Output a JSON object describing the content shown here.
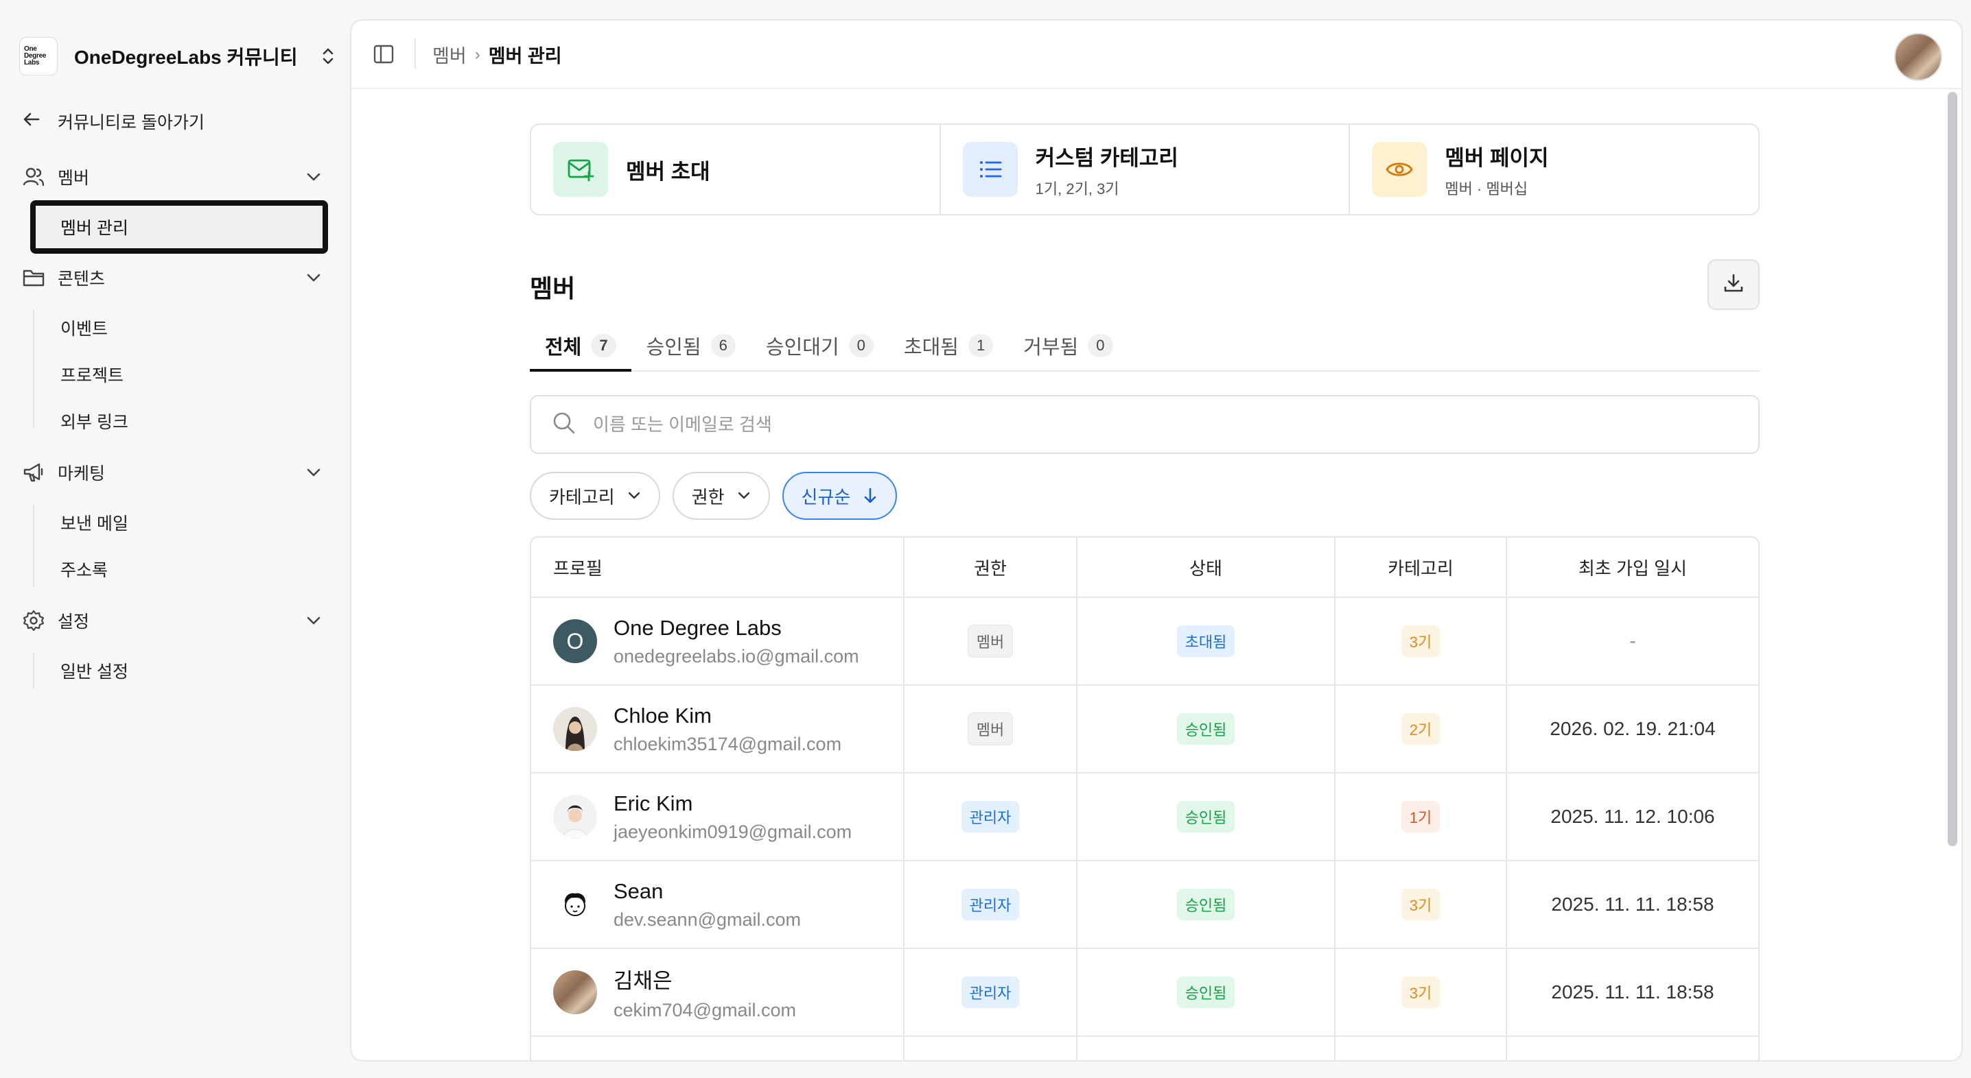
{
  "workspace": {
    "logo_text": "One Degree Labs",
    "name": "OneDegreeLabs 커뮤니티"
  },
  "sidebar": {
    "back_label": "커뮤니티로 돌아가기",
    "sections": [
      {
        "label": "멤버",
        "icon": "users-icon",
        "items": [
          {
            "label": "멤버 관리",
            "active": true
          }
        ]
      },
      {
        "label": "콘텐츠",
        "icon": "folder-icon",
        "items": [
          {
            "label": "이벤트"
          },
          {
            "label": "프로젝트"
          },
          {
            "label": "외부 링크"
          }
        ]
      },
      {
        "label": "마케팅",
        "icon": "megaphone-icon",
        "items": [
          {
            "label": "보낸 메일"
          },
          {
            "label": "주소록"
          }
        ]
      },
      {
        "label": "설정",
        "icon": "gear-icon",
        "items": [
          {
            "label": "일반 설정"
          }
        ]
      }
    ]
  },
  "breadcrumb": {
    "parent": "멤버",
    "current": "멤버 관리"
  },
  "cards": [
    {
      "title": "멤버 초대",
      "subtitle": "",
      "icon": "mail-plus-icon",
      "color": "#16a34a",
      "bg": "#dcf5e6"
    },
    {
      "title": "커스텀 카테고리",
      "subtitle": "1기, 2기, 3기",
      "icon": "list-icon",
      "color": "#2563eb",
      "bg": "#e3eefc"
    },
    {
      "title": "멤버 페이지",
      "subtitle": "멤버 · 멤버십",
      "icon": "eye-icon",
      "color": "#d97706",
      "bg": "#fdf1cf"
    }
  ],
  "members": {
    "title": "멤버",
    "tabs": [
      {
        "label": "전체",
        "count": "7",
        "active": true
      },
      {
        "label": "승인됨",
        "count": "6"
      },
      {
        "label": "승인대기",
        "count": "0"
      },
      {
        "label": "초대됨",
        "count": "1"
      },
      {
        "label": "거부됨",
        "count": "0"
      }
    ],
    "search_placeholder": "이름 또는 이메일로 검색",
    "filters": {
      "category": "카테고리",
      "role": "권한",
      "sort": "신규순"
    },
    "columns": {
      "profile": "프로필",
      "role": "권한",
      "status": "상태",
      "category": "카테고리",
      "joined": "최초 가입 일시"
    },
    "rows": [
      {
        "name": "One Degree Labs",
        "email": "onedegreelabs.io@gmail.com",
        "role": "멤버",
        "status": "초대됨",
        "category": "3기",
        "joined": "-",
        "avatar_initial": "O"
      },
      {
        "name": "Chloe Kim",
        "email": "chloekim35174@gmail.com",
        "role": "멤버",
        "status": "승인됨",
        "category": "2기",
        "joined": "2026. 02. 19. 21:04"
      },
      {
        "name": "Eric Kim",
        "email": "jaeyeonkim0919@gmail.com",
        "role": "관리자",
        "status": "승인됨",
        "category": "1기",
        "joined": "2025. 11. 12. 10:06"
      },
      {
        "name": "Sean",
        "email": "dev.seann@gmail.com",
        "role": "관리자",
        "status": "승인됨",
        "category": "3기",
        "joined": "2025. 11. 11. 18:58"
      },
      {
        "name": "김채은",
        "email": "cekim704@gmail.com",
        "role": "관리자",
        "status": "승인됨",
        "category": "3기",
        "joined": "2025. 11. 11. 18:58"
      }
    ]
  }
}
